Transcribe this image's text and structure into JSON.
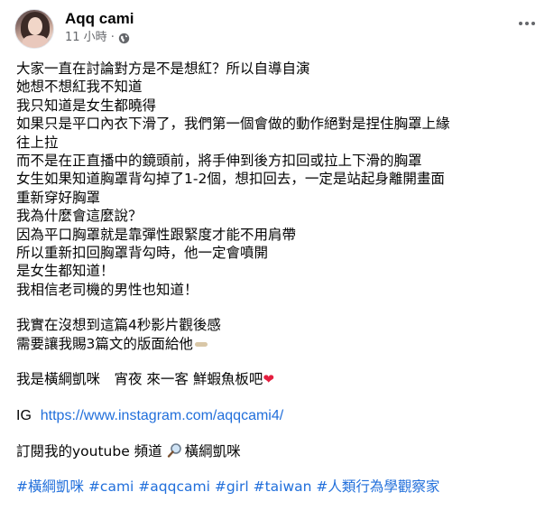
{
  "post": {
    "author": "Aqq cami",
    "time": "11 小時",
    "separator": "·",
    "icons": {
      "audience": "globe-icon",
      "more": "more-options-icon"
    },
    "paragraph1": [
      "大家一直在討論對方是不是想紅？所以自導自演",
      "她想不想紅我不知道",
      "我只知道是女生都曉得",
      "如果只是平口內衣下滑了，我們第一個會做的動作絕對是捏住胸罩上緣",
      "往上拉",
      "而不是在正直播中的鏡頭前，將手伸到後方扣回或拉上下滑的胸罩",
      "女生如果知道胸罩背勾掉了1-2個，想扣回去，一定是站起身離開畫面",
      "重新穿好胸罩",
      "我為什麼會這麼說？",
      "因為平口胸罩就是靠彈性跟緊度才能不用肩帶",
      "所以重新扣回胸罩背勾時，他一定會噴開",
      "是女生都知道！",
      "我相信老司機的男性也知道！"
    ],
    "paragraph2": [
      "我實在沒想到這篇4秒影片觀後感",
      "需要讓我賜3篇文的版面給他"
    ],
    "paragraph3": "我是橫綱凱咪　宵夜 來一客 鮮蝦魚板吧",
    "heart": "❤",
    "ig_label": "IG",
    "ig_url": "https://www.instagram.com/aqqcami4/",
    "youtube_text": "訂閱我的youtube 頻道",
    "youtube_name": "橫綱凱咪",
    "hashtags": [
      "#橫綱凱咪",
      "#cami",
      "#aqqcami",
      "#girl",
      "#taiwan",
      "#人類行為學觀察家"
    ],
    "colors": {
      "link": "#216fdb",
      "muted": "#65676b",
      "heart": "#e41e3f"
    }
  }
}
